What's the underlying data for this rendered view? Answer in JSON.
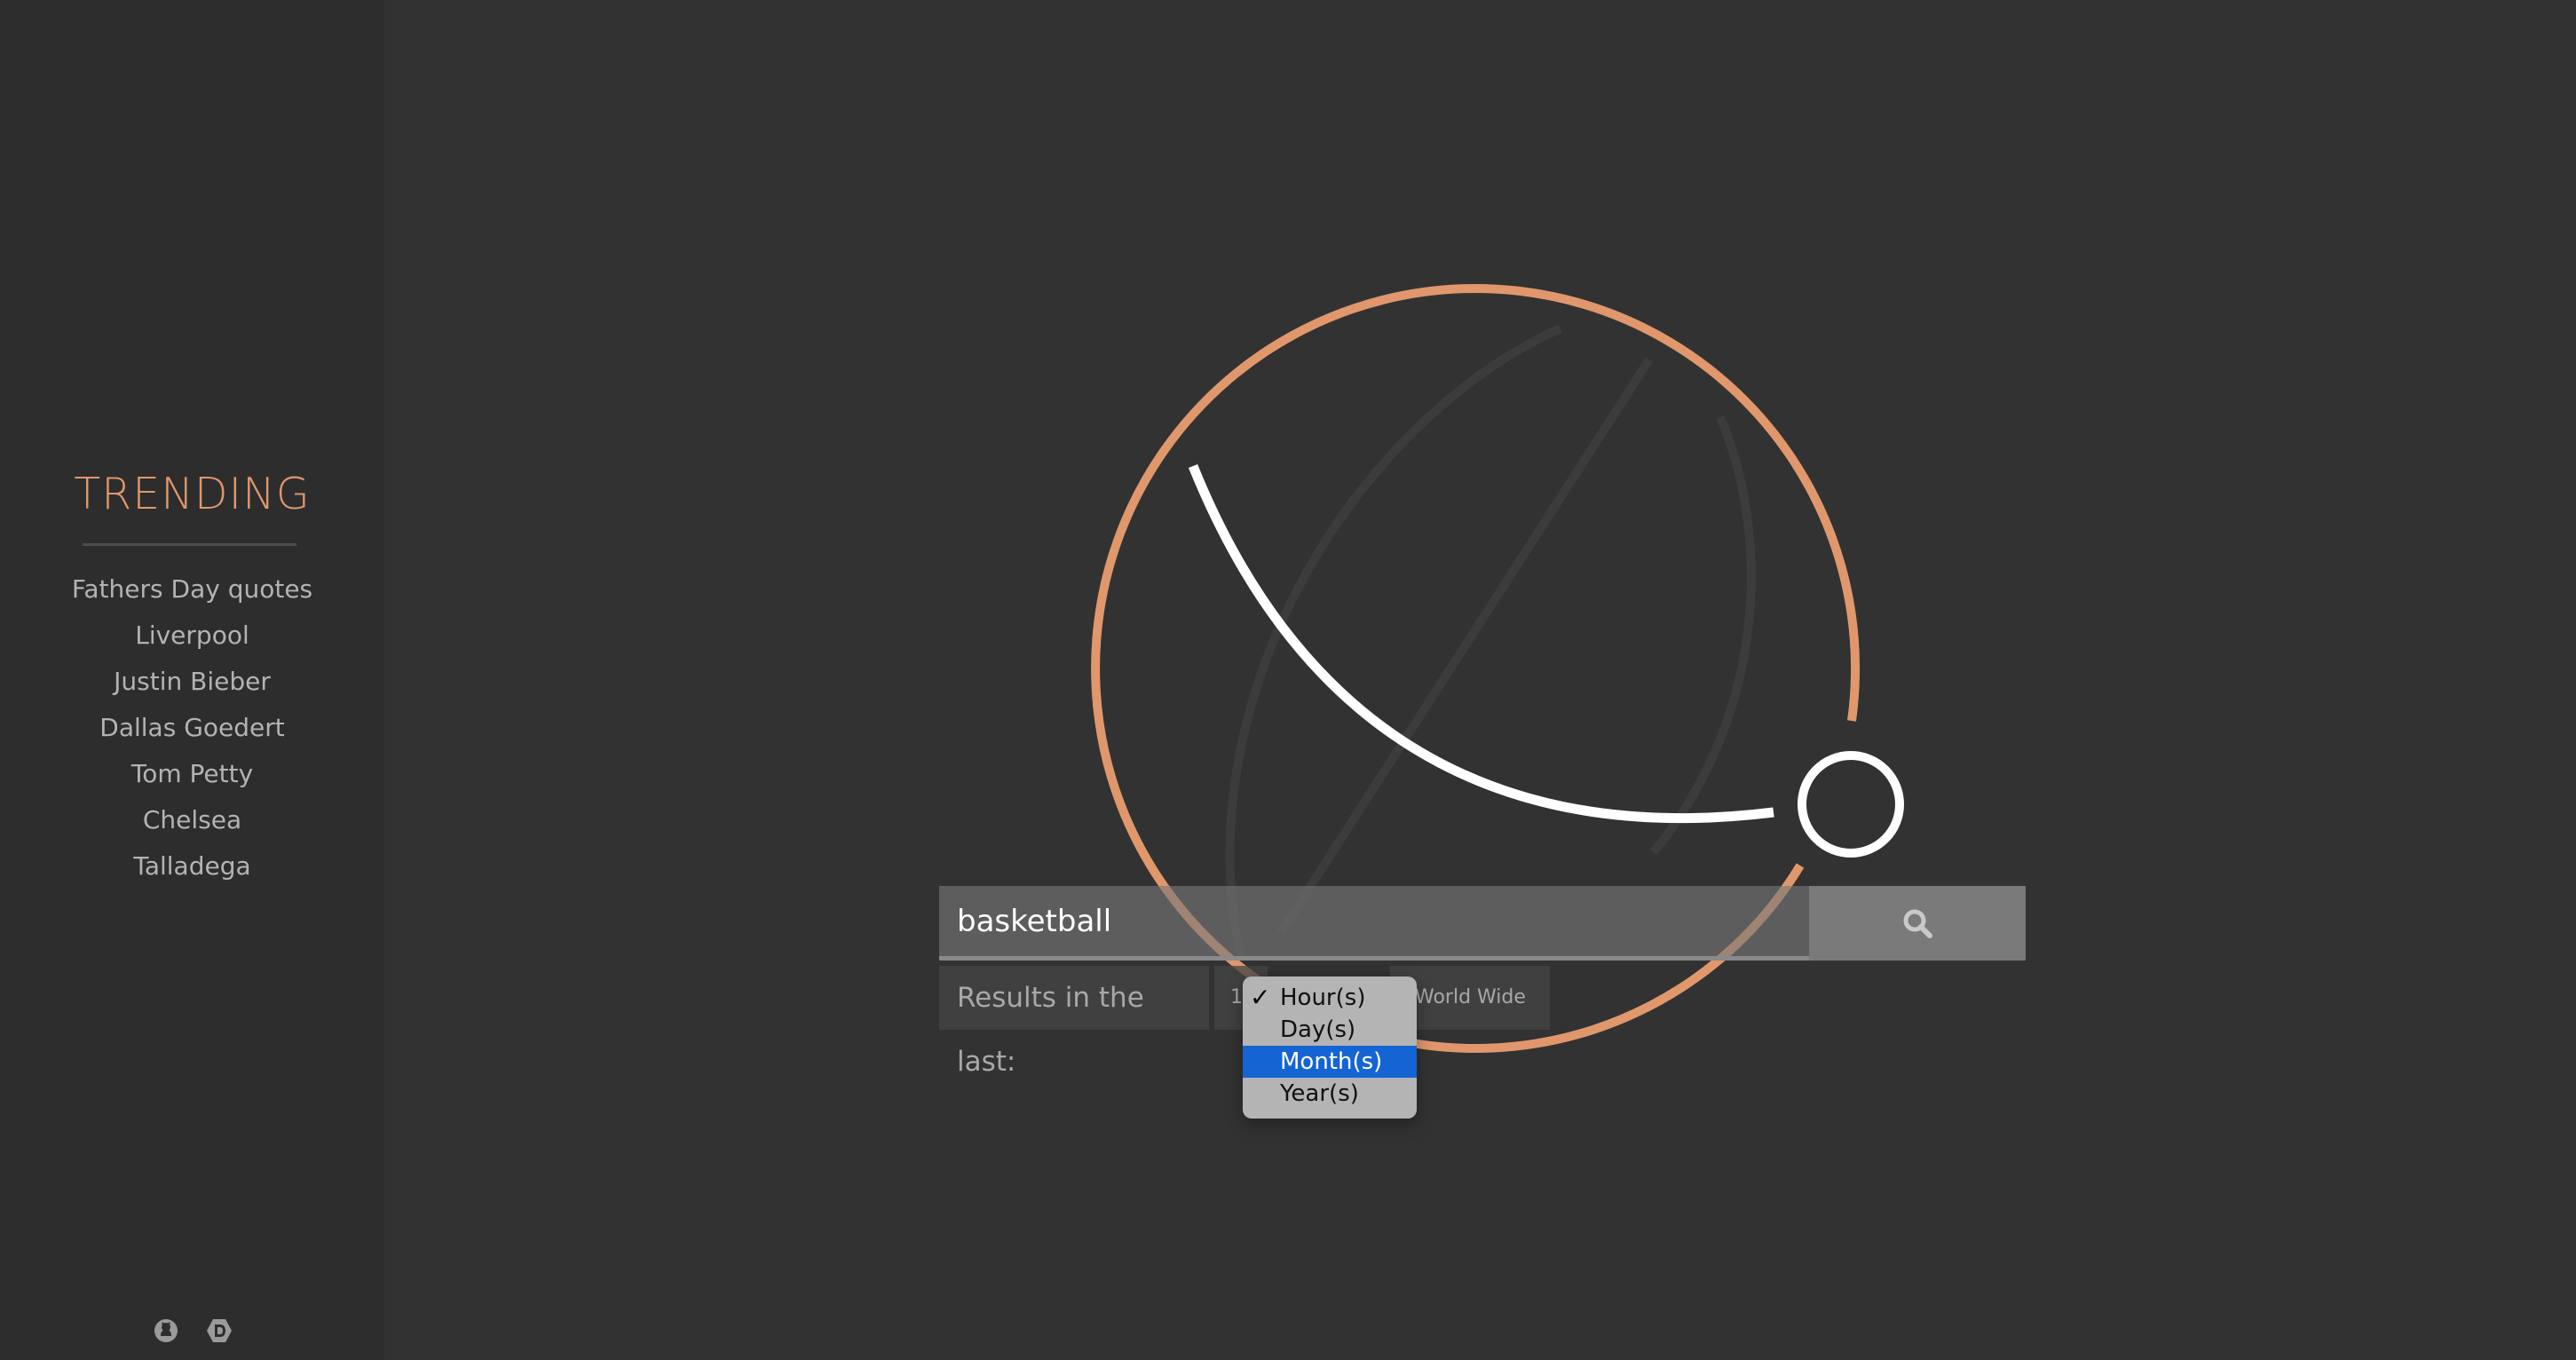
{
  "sidebar": {
    "title": "TRENDING",
    "items": [
      {
        "label": "Fathers Day quotes"
      },
      {
        "label": "Liverpool"
      },
      {
        "label": "Justin Bieber"
      },
      {
        "label": "Dallas Goedert"
      },
      {
        "label": "Tom Petty"
      },
      {
        "label": "Chelsea"
      },
      {
        "label": "Talladega"
      }
    ],
    "footer_icons": [
      "github-icon",
      "devpost-icon"
    ]
  },
  "search": {
    "value": "basketball",
    "button_icon": "search-icon"
  },
  "filters": {
    "label": "Results in the last:",
    "number_value": "1",
    "region_value": "World Wide"
  },
  "dropdown": {
    "options": [
      {
        "label": "Hour(s)",
        "checked": true
      },
      {
        "label": "Day(s)"
      },
      {
        "label": "Month(s)",
        "highlighted": true
      },
      {
        "label": "Year(s)"
      }
    ],
    "check_glyph": "✓"
  },
  "colors": {
    "accent": "#e0976c",
    "background": "#323232",
    "sidebar": "#2d2d2d",
    "highlight": "#1464d4"
  }
}
